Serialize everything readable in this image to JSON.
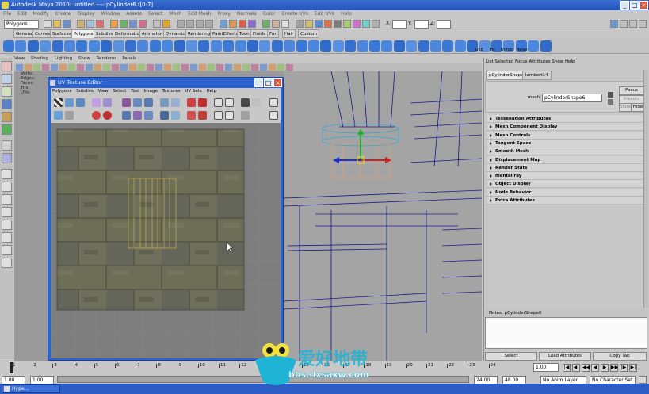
{
  "window": {
    "title": "Autodesk Maya 2010: untitled   ----   pCylinder6.f[0:7]"
  },
  "menubar": [
    "File",
    "Edit",
    "Modify",
    "Create",
    "Display",
    "Window",
    "Assets",
    "Select",
    "Mesh",
    "Edit Mesh",
    "Proxy",
    "Normals",
    "Color",
    "Create UVs",
    "Edit UVs",
    "Help"
  ],
  "status_line": {
    "mode_select": "Polygons",
    "x_label": "X:",
    "y_label": "Y:",
    "z_label": "Z:"
  },
  "shelf_tabs": [
    "General",
    "Curves",
    "Surfaces",
    "Polygons",
    "Subdivs",
    "Deformation",
    "Animation",
    "Dynamics",
    "Rendering",
    "PaintEffects",
    "Toon",
    "Fluids",
    "Fur",
    "Hair",
    "Custom"
  ],
  "shelf_active": "Polygons",
  "shelf_labels": [
    "UTE",
    "Fix",
    "Unfold",
    "Relax"
  ],
  "panel_menu": [
    "View",
    "Shading",
    "Lighting",
    "Show",
    "Renderer",
    "Panels"
  ],
  "hud": [
    "Verts:",
    "Edges:",
    "Faces:",
    "Tris:",
    "UVs:"
  ],
  "uv_editor": {
    "title": "UV Texture Editor",
    "menu": [
      "Polygons",
      "Subdivs",
      "View",
      "Select",
      "Tool",
      "Image",
      "Textures",
      "UV Sets",
      "Help"
    ]
  },
  "attribute_editor": {
    "menu": [
      "List",
      "Selected",
      "Focus",
      "Attributes",
      "Show",
      "Help"
    ],
    "tabs": [
      "pCylinderShape6",
      "lambert14"
    ],
    "mesh_label": "mesh:",
    "mesh_value": "pCylinderShape6",
    "buttons": {
      "focus": "Focus",
      "presets": "Presets",
      "show": "Show",
      "hide": "Hide"
    },
    "sections": [
      "Tessellation Attributes",
      "Mesh Component Display",
      "Mesh Controls",
      "Tangent Space",
      "Smooth Mesh",
      "Displacement Map",
      "Render Stats",
      "mental ray",
      "Object Display",
      "Node Behavior",
      "Extra Attributes"
    ],
    "notes_label": "Notes:  pCylinderShape6",
    "bottom_buttons": [
      "Select",
      "Load Attributes",
      "Copy Tab"
    ]
  },
  "timeline": {
    "ticks": [
      "1",
      "2",
      "3",
      "4",
      "5",
      "6",
      "7",
      "8",
      "9",
      "10",
      "11",
      "12",
      "13",
      "14",
      "15",
      "16",
      "17",
      "18",
      "19",
      "20",
      "21",
      "22",
      "23",
      "24"
    ],
    "current_frame": "1.00",
    "range_start": "1.00",
    "range_start2": "1.00",
    "range_end": "24.00",
    "range_end2": "48.00",
    "anim_layer": "No Anim Layer",
    "character_set": "No Character Set"
  },
  "taskbar": {
    "item": "Hype..."
  },
  "watermark": {
    "text": "爱好地带",
    "url": "bbs.dxsaxw.com"
  },
  "colors": {
    "title_blue": "#2456b8",
    "uv_window_blue": "#2a63d0",
    "wire_blue": "#1a1a8a",
    "uv_shell_yellow": "#e8c040",
    "watermark_cyan": "#1fb4d6"
  }
}
